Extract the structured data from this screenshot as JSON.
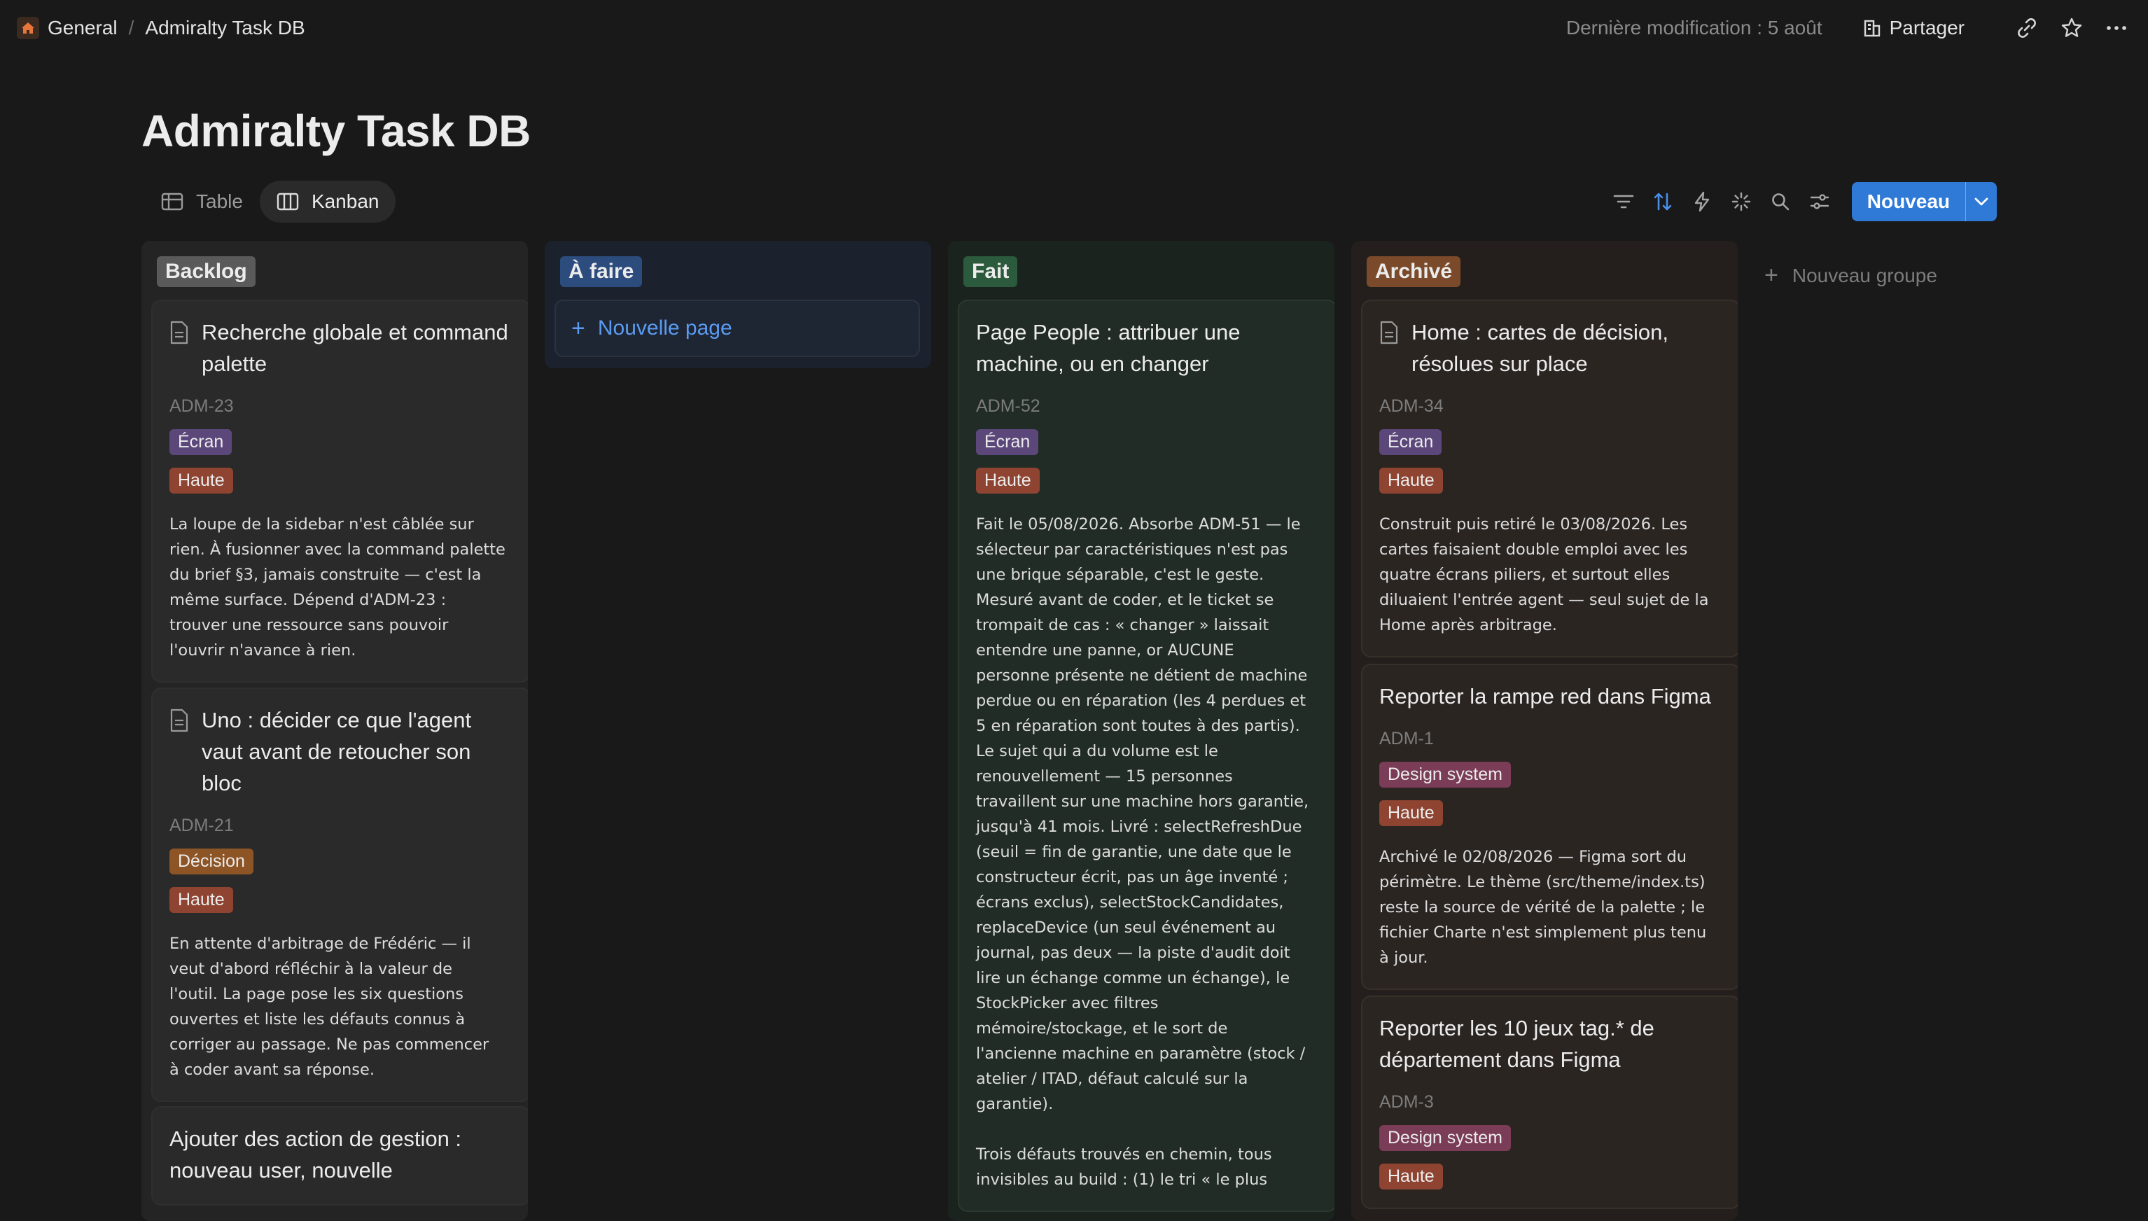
{
  "breadcrumb": {
    "workspace": "General",
    "page": "Admiralty Task DB"
  },
  "topbar": {
    "last_modified": "Dernière modification : 5 août",
    "share_label": "Partager"
  },
  "page_title": "Admiralty Task DB",
  "views": [
    {
      "label": "Table",
      "icon": "table-icon",
      "active": false
    },
    {
      "label": "Kanban",
      "icon": "kanban-icon",
      "active": true
    }
  ],
  "toolbar": {
    "new_label": "Nouveau",
    "icons": [
      "filter-icon",
      "sort-icon",
      "automation-icon",
      "ai-icon",
      "search-icon",
      "settings-icon"
    ]
  },
  "colors": {
    "accent": "#2e7ad6",
    "backlog": "#5a5a5a",
    "a_faire": "#2c4c7e",
    "fait": "#2b5a3c",
    "archive": "#7a4a2a"
  },
  "board": {
    "new_page_label": "Nouvelle page",
    "new_group_label": "Nouveau groupe",
    "columns": [
      {
        "name": "Backlog",
        "cards": [
          {
            "title": "Recherche globale et command palette",
            "id": "ADM-23",
            "tags": [
              "Écran",
              "Haute"
            ],
            "desc": "La loupe de la sidebar n'est câblée sur\nrien. À fusionner avec la command palette\ndu brief §3, jamais construite — c'est la\nmême surface. Dépend d'ADM-23 :\ntrouver une ressource sans pouvoir\nl'ouvrir n'avance à rien."
          },
          {
            "title": "Uno : décider ce que l'agent vaut avant de retoucher son bloc",
            "id": "ADM-21",
            "tags": [
              "Décision",
              "Haute"
            ],
            "desc": "En attente d'arbitrage de Frédéric — il\nveut d'abord réfléchir à la valeur de\nl'outil. La page pose les six questions\nouvertes et liste les défauts connus à\ncorriger au passage. Ne pas commencer\nà coder avant sa réponse."
          },
          {
            "title": "Ajouter des action de gestion : nouveau user, nouvelle"
          }
        ]
      },
      {
        "name": "À faire",
        "cards": []
      },
      {
        "name": "Fait",
        "cards": [
          {
            "title": "Page People : attribuer une machine, ou en changer",
            "id": "ADM-52",
            "tags": [
              "Écran",
              "Haute"
            ],
            "desc": "Fait le 05/08/2026. Absorbe ADM-51 — le\nsélecteur par caractéristiques n'est pas\nune brique séparable, c'est le geste.\nMesuré avant de coder, et le ticket se\ntrompait de cas : « changer » laissait\nentendre une panne, or AUCUNE\npersonne présente ne détient de machine\nperdue ou en réparation (les 4 perdues et\n5 en réparation sont toutes à des partis).\nLe sujet qui a du volume est le\nrenouvellement — 15 personnes\ntravaillent sur une machine hors garantie,\njusqu'à 41 mois. Livré : selectRefreshDue\n(seuil = fin de garantie, une date que le\nconstructeur écrit, pas un âge inventé ;\nécrans exclus), selectStockCandidates,\nreplaceDevice (un seul événement au\njournal, pas deux — la piste d'audit doit\nlire un échange comme un échange), le\nStockPicker avec filtres\nmémoire/stockage, et le sort de\nl'ancienne machine en paramètre (stock /\natelier / ITAD, défaut calculé sur la\ngarantie).\n\nTrois défauts trouvés en chemin, tous\ninvisibles au build : (1) le tri « le plus"
          }
        ]
      },
      {
        "name": "Archivé",
        "cards": [
          {
            "title": "Home : cartes de décision, résolues sur place",
            "id": "ADM-34",
            "tags": [
              "Écran",
              "Haute"
            ],
            "desc": "Construit puis retiré le 03/08/2026. Les\ncartes faisaient double emploi avec les\nquatre écrans piliers, et surtout elles\ndiluaient l'entrée agent — seul sujet de la\nHome après arbitrage."
          },
          {
            "title": "Reporter la rampe red dans Figma",
            "id": "ADM-1",
            "tags": [
              "Design system",
              "Haute"
            ],
            "desc": "Archivé le 02/08/2026 — Figma sort du\npérimètre. Le thème (src/theme/index.ts)\nreste la source de vérité de la palette ; le\nfichier Charte n'est simplement plus tenu\nà jour."
          },
          {
            "title": "Reporter les 10 jeux tag.* de département dans Figma",
            "id": "ADM-3",
            "tags": [
              "Design system",
              "Haute"
            ]
          }
        ]
      }
    ]
  }
}
